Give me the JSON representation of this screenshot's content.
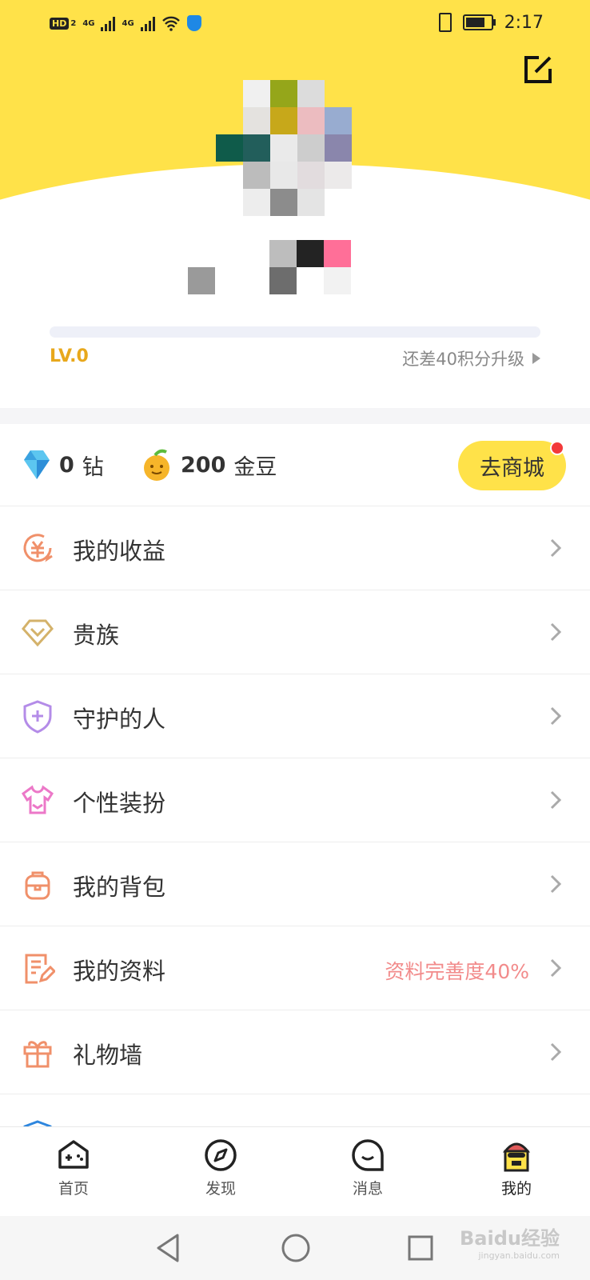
{
  "status_bar": {
    "hd": "HD",
    "hd_sub": "2",
    "net1": "4G",
    "net2": "4G",
    "time": "2:17"
  },
  "profile": {
    "level": "LV.0",
    "upgrade_hint": "还差40积分升级",
    "progress_fraction": 0
  },
  "wallet": {
    "diamonds_value": "0",
    "diamonds_unit": "钻",
    "beans_value": "200",
    "beans_unit": "金豆",
    "shop_label": "去商城"
  },
  "menu": [
    {
      "label": "我的收益",
      "icon": "yuan-refresh-icon",
      "color": "#f0906a",
      "extra": ""
    },
    {
      "label": "贵族",
      "icon": "diamond-icon",
      "color": "#d4b26a",
      "extra": ""
    },
    {
      "label": "守护的人",
      "icon": "shield-plus-icon",
      "color": "#b48ce8",
      "extra": ""
    },
    {
      "label": "个性装扮",
      "icon": "tshirt-icon",
      "color": "#ec78c8",
      "extra": ""
    },
    {
      "label": "我的背包",
      "icon": "backpack-icon",
      "color": "#f0906a",
      "extra": ""
    },
    {
      "label": "我的资料",
      "icon": "document-edit-icon",
      "color": "#f0906a",
      "extra": "资料完善度40%"
    },
    {
      "label": "礼物墙",
      "icon": "gift-icon",
      "color": "#f0906a",
      "extra": ""
    }
  ],
  "tabs": [
    {
      "label": "首页",
      "icon": "home-game-icon",
      "active": false
    },
    {
      "label": "发现",
      "icon": "compass-icon",
      "active": false
    },
    {
      "label": "消息",
      "icon": "chat-bubble-icon",
      "active": false
    },
    {
      "label": "我的",
      "icon": "profile-avatar-icon",
      "active": true
    }
  ],
  "watermark": {
    "text": "Baidu经验",
    "sub": "jingyan.baidu.com"
  },
  "colors": {
    "accent": "#ffe249",
    "level": "#e8a81c",
    "badge_red": "#f33a3a"
  }
}
